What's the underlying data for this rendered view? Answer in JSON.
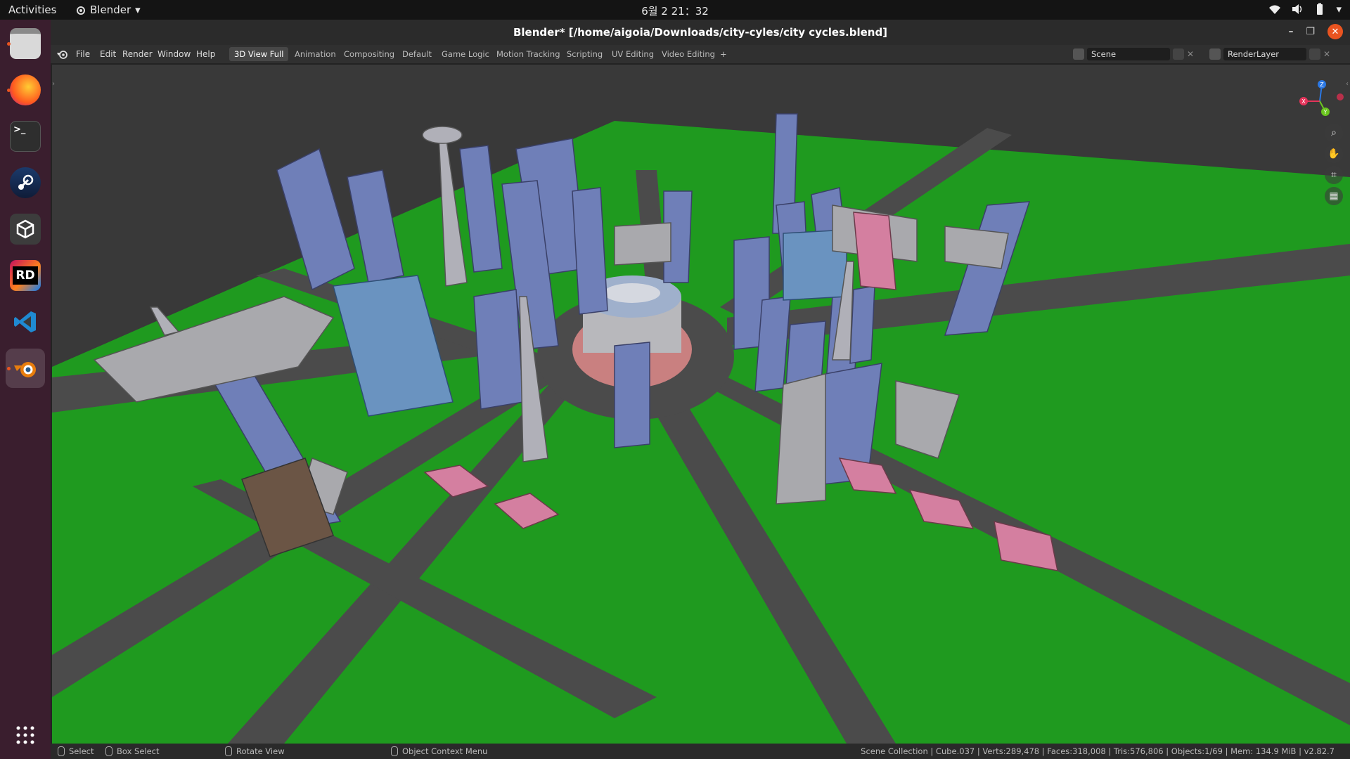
{
  "topbar": {
    "activities": "Activities",
    "app_name": "Blender",
    "clock": "6월 2 21：32"
  },
  "dock": {
    "items": [
      {
        "name": "files",
        "label": ""
      },
      {
        "name": "firefox",
        "label": ""
      },
      {
        "name": "terminal",
        "label": ">_"
      },
      {
        "name": "steam",
        "label": ""
      },
      {
        "name": "unity",
        "label": ""
      },
      {
        "name": "rider",
        "label": "RD"
      },
      {
        "name": "vscode",
        "label": ""
      },
      {
        "name": "blender",
        "label": ""
      }
    ]
  },
  "window": {
    "title": "Blender* [/home/aigoia/Downloads/city-cyles/city cycles.blend]"
  },
  "menubar": {
    "menus": [
      "File",
      "Edit",
      "Render",
      "Window",
      "Help"
    ],
    "workspaces": [
      "3D View Full",
      "Animation",
      "Compositing",
      "Default",
      "Game Logic",
      "Motion Tracking",
      "Scripting",
      "UV Editing",
      "Video Editing"
    ],
    "active_workspace": "3D View Full",
    "add_tab": "+",
    "scene": "Scene",
    "render_layer": "RenderLayer"
  },
  "gizmo": {
    "z": "Z",
    "x": "X",
    "y": "Y"
  },
  "colors": {
    "ground": "#1f9a1f",
    "road": "#4a4a4a",
    "building_blue": "#6f7fb8",
    "building_gray": "#a9a9ad",
    "roof_pink": "#d47fa0",
    "accent": "#e95420"
  },
  "statusbar": {
    "select": "Select",
    "box_select": "Box Select",
    "rotate_view": "Rotate View",
    "context_menu": "Object Context Menu",
    "stats": "Scene Collection | Cube.037 | Verts:289,478 | Faces:318,008 | Tris:576,806 | Objects:1/69 | Mem: 134.9 MiB | v2.82.7"
  }
}
